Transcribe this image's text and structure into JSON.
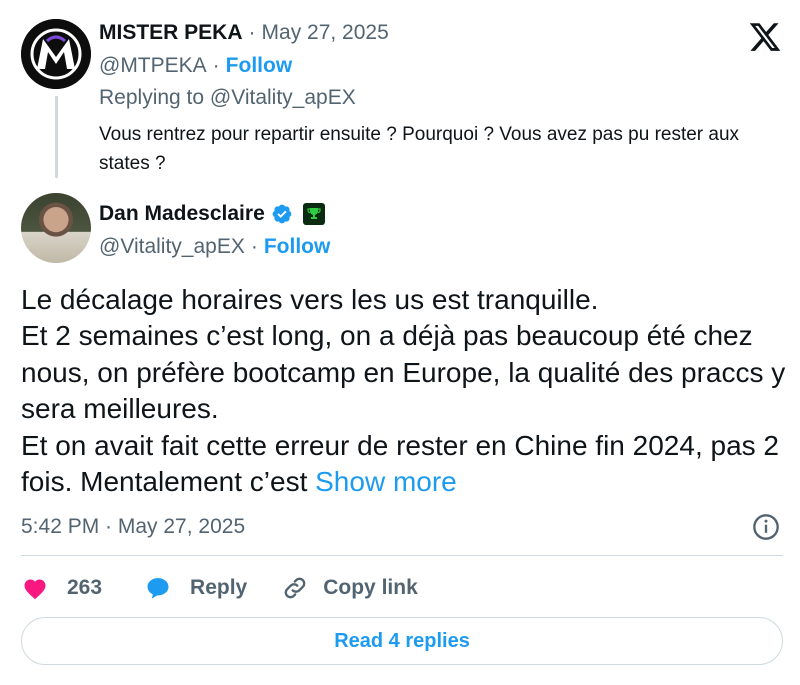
{
  "parent_tweet": {
    "author_name": "MISTER PEKA",
    "separator": "·",
    "date": "May 27, 2025",
    "handle": "@MTPEKA",
    "follow_label": "Follow",
    "replying_to": "Replying to @Vitality_apEX",
    "text": "Vous rentrez pour repartir ensuite ? Pourquoi ? Vous avez pas pu rester aux states ?"
  },
  "main_tweet": {
    "author_name": "Dan Madesclaire",
    "handle": "@Vitality_apEX",
    "separator": "·",
    "follow_label": "Follow",
    "text_lines": [
      "Le décalage horaires vers les us est tranquille.",
      "Et 2 semaines c’est long, on a déjà pas beaucoup été chez nous, on préfère bootcamp en Europe, la qualité des praccs y sera meilleures.",
      "Et on avait fait cette erreur de rester en Chine fin 2024, pas 2 fois. Mentalement c’est"
    ],
    "show_more_label": "Show more",
    "timestamp": "5:42 PM · May 27, 2025"
  },
  "actions": {
    "like_count": "263",
    "reply_label": "Reply",
    "copy_link_label": "Copy link"
  },
  "read_replies_label": "Read 4 replies",
  "colors": {
    "accent": "#1d9bf0",
    "like": "#f91880",
    "text": "#0f1419",
    "secondary": "#536471",
    "border": "#cfd9de"
  }
}
